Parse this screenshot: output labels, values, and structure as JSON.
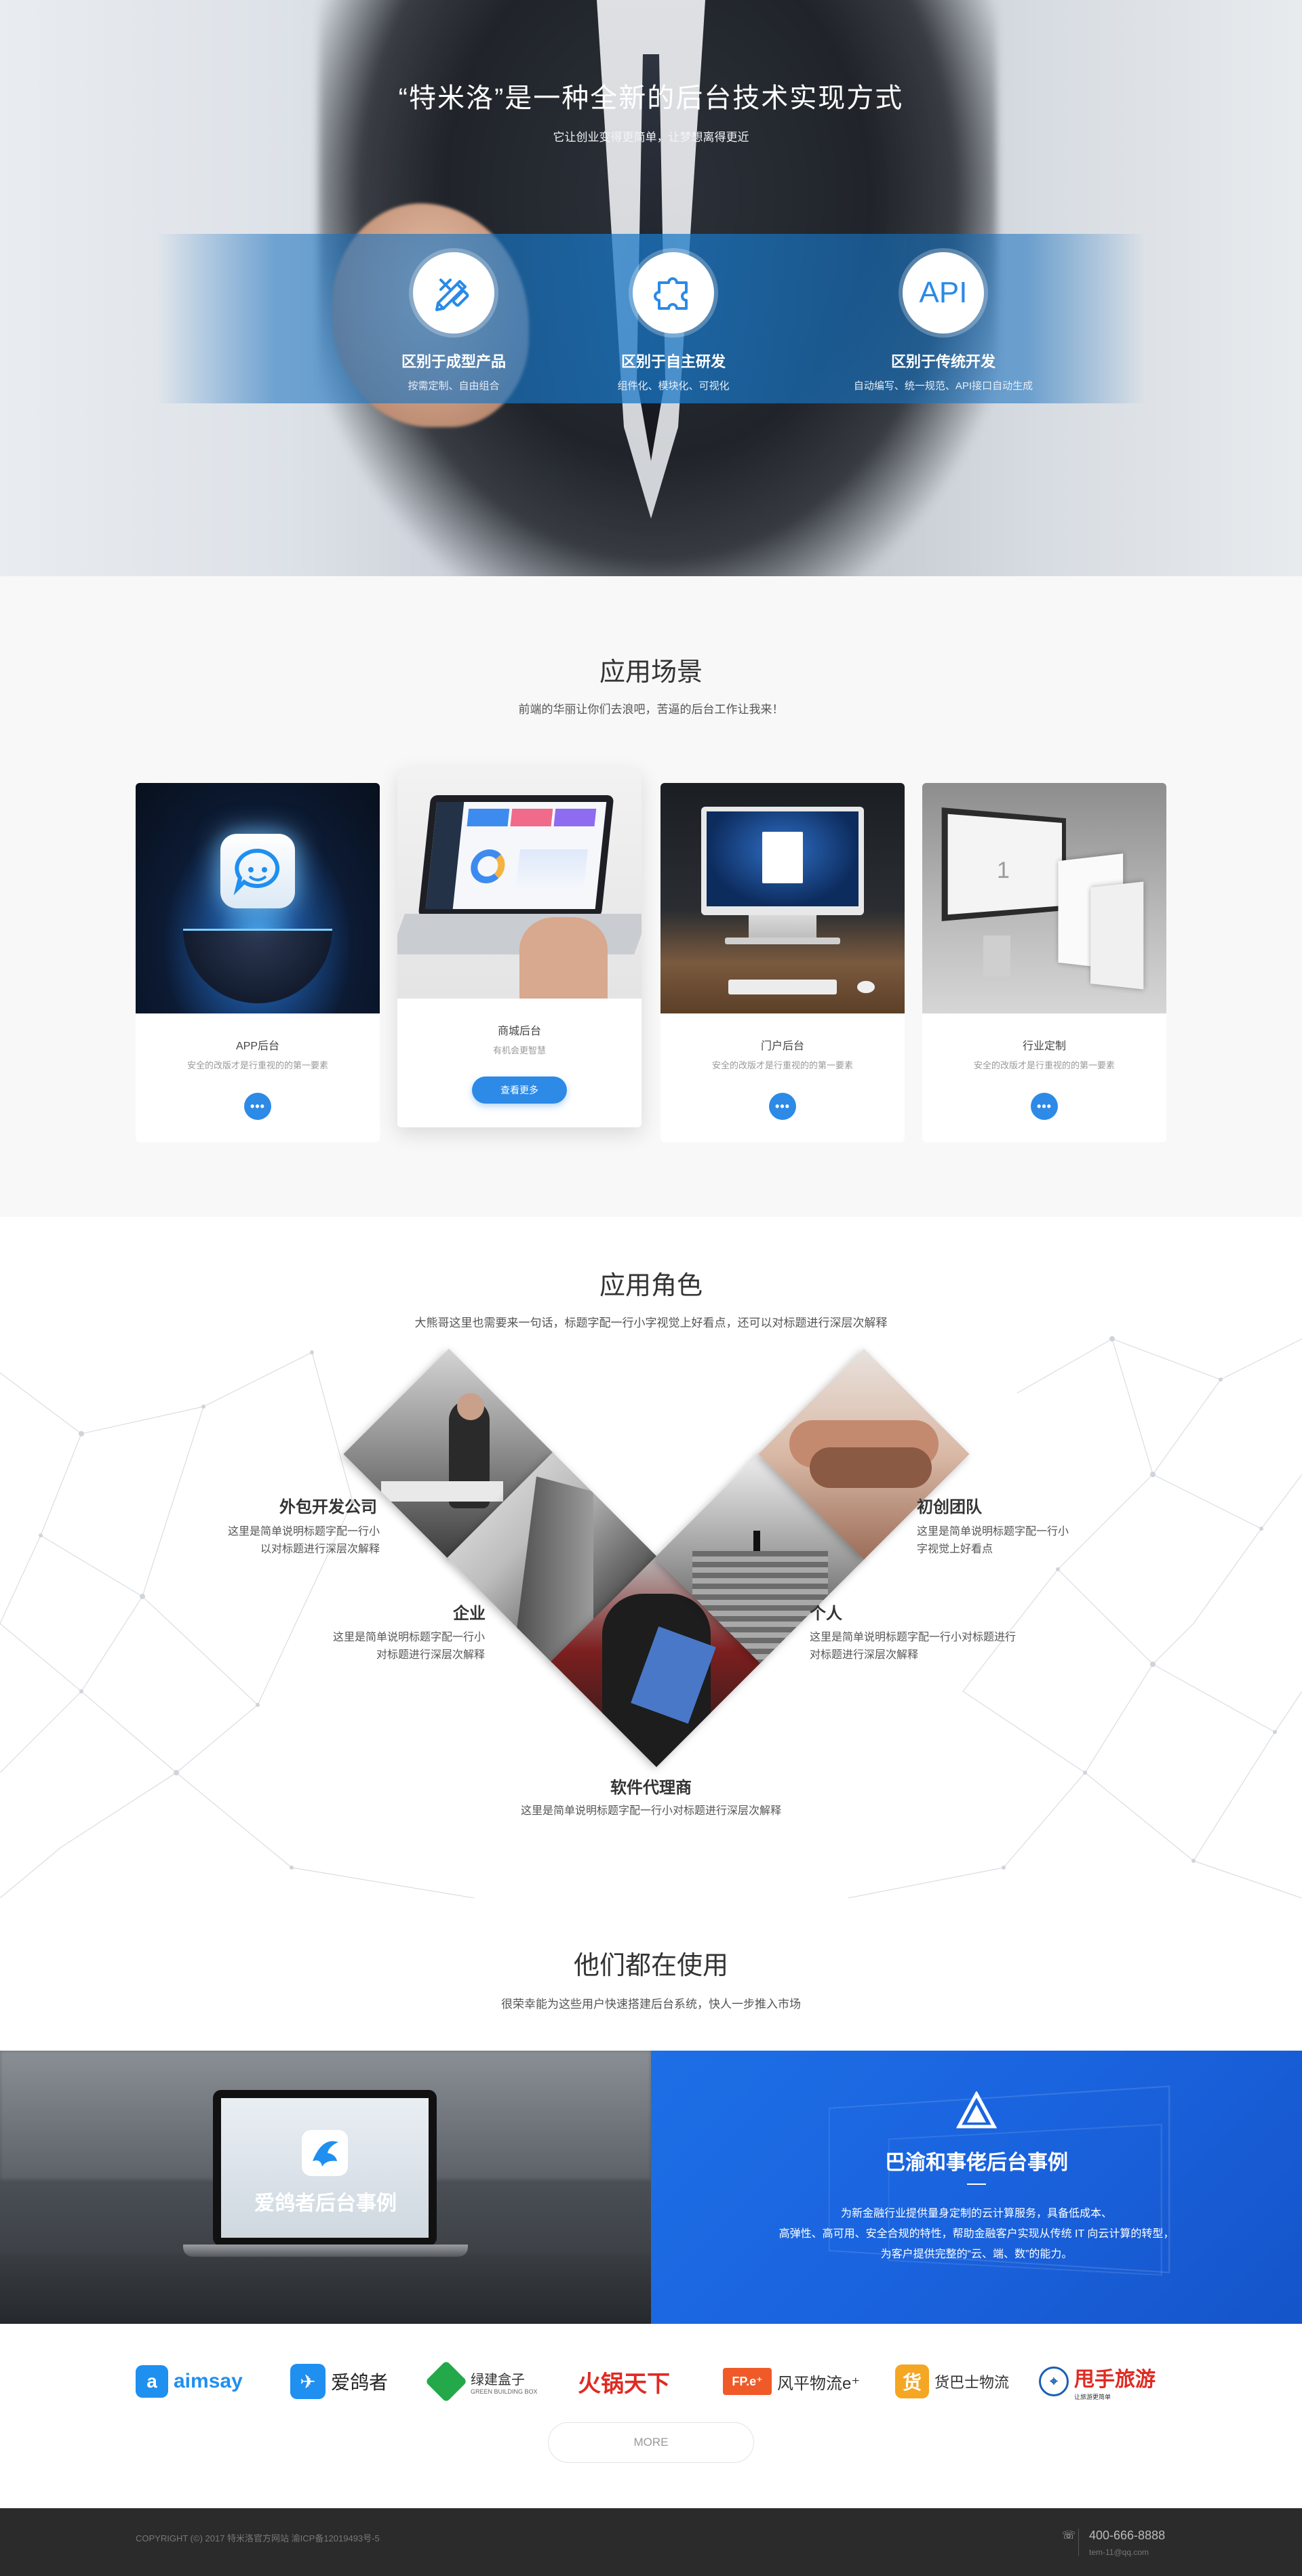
{
  "hero": {
    "title": "“特米洛”是一种全新的后台技术实现方式",
    "subtitle": "它让创业变得更简单，让梦想离得更近",
    "features": [
      {
        "title": "区别于成型产品",
        "desc": "按需定制、自由组合",
        "icon": "tools-icon"
      },
      {
        "title": "区别于自主研发",
        "desc": "组件化、模块化、可视化",
        "icon": "puzzle-icon"
      },
      {
        "title": "区别于传统开发",
        "desc": "自动编写、统一规范、API接口自动生成",
        "icon": "api-icon",
        "icon_text": "API"
      }
    ]
  },
  "scenes": {
    "title": "应用场景",
    "subtitle": "前端的华丽让你们去浪吧，苦逼的后台工作让我来！",
    "cards": [
      {
        "title": "APP后台",
        "desc": "安全的改版才是行重视的的第一要素"
      },
      {
        "title": "商城后台",
        "desc": "有机会更智慧",
        "button": "查看更多"
      },
      {
        "title": "门户后台",
        "desc": "安全的改版才是行重视的的第一要素"
      },
      {
        "title": "行业定制",
        "desc": "安全的改版才是行重视的的第一要素"
      }
    ],
    "dots": "•••"
  },
  "roles": {
    "title": "应用角色",
    "subtitle": "大熊哥这里也需要来一句话，标题字配一行小字视觉上好看点，还可以对标题进行深层次解释",
    "items": [
      {
        "name": "外包开发公司",
        "desc1": "这里是简单说明标题字配一行小",
        "desc2": "以对标题进行深层次解释"
      },
      {
        "name": "企业",
        "desc1": "这里是简单说明标题字配一行小",
        "desc2": "对标题进行深层次解释"
      },
      {
        "name": "软件代理商",
        "desc1": "这里是简单说明标题字配一行小对标题进行深层次解释",
        "desc2": ""
      },
      {
        "name": "个人",
        "desc1": "这里是简单说明标题字配一行小对标题进行",
        "desc2": "对标题进行深层次解释"
      },
      {
        "name": "初创团队",
        "desc1": "这里是简单说明标题字配一行小",
        "desc2": "字视觉上好看点"
      }
    ]
  },
  "clients": {
    "title": "他们都在使用",
    "subtitle": "很荣幸能为这些用户快速搭建后台系统，快人一步推入市场",
    "case_left": {
      "title": "爱鸽者后台事例"
    },
    "case_right": {
      "title": "巴渝和事佬后台事例",
      "desc1": "为新金融行业提供量身定制的云计算服务，具备低成本、",
      "desc2": "高弹性、高可用、安全合规的特性，帮助金融客户实现从传统 IT 向云计算的转型，",
      "desc3": "为客户提供完整的“云、端、数”的能力。"
    },
    "logos": [
      {
        "name": "aimsay",
        "color": "#1f8ff0"
      },
      {
        "name": "爱鸽者",
        "color": "#1f8ff0"
      },
      {
        "name": "绿建盒子",
        "sub": "GREEN BUILDING BOX",
        "color": "#23a84a"
      },
      {
        "name": "火锅天下",
        "color": "#e02a22"
      },
      {
        "name": "风平物流e⁺",
        "badge": "FP.e⁺",
        "color": "#f05a28"
      },
      {
        "name": "货巴士物流",
        "badge": "货",
        "color": "#f5a623"
      },
      {
        "name": "甩手旅游",
        "sub": "让旅游更简单",
        "color": "#e02a22"
      }
    ],
    "more": "MORE"
  },
  "footer": {
    "copyright": "COPYRIGHT (©) 2017 特米洛官方网站   渝ICP备12019493号-5",
    "phone": "400-666-8888",
    "email": "tem-11@qq.com"
  }
}
